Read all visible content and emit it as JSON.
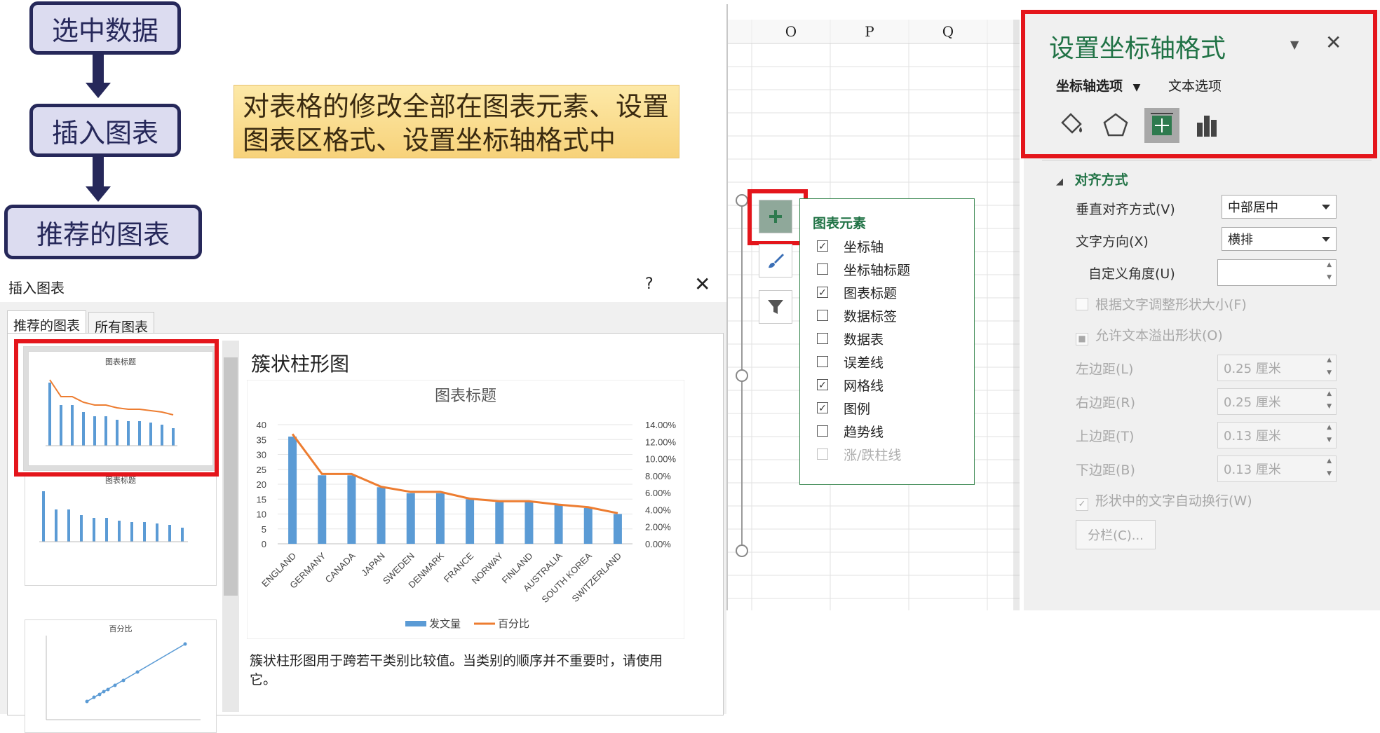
{
  "flow": {
    "step1": "选中数据",
    "step2": "插入图表",
    "step3": "推荐的图表"
  },
  "note": {
    "line1": "对表格的修改全部在图表元素、设置",
    "line2": "图表区格式、设置坐标轴格式中"
  },
  "dialog": {
    "title": "插入图表",
    "help": "?",
    "close": "✕",
    "tabs": [
      "推荐的图表",
      "所有图表"
    ],
    "chart_name": "簇状柱形图",
    "description": "簇状柱形图用于跨若干类别比较值。当类别的顺序并不重要时，请使用它。",
    "thumb_titles": [
      "图表标题",
      "图表标题",
      "百分比"
    ]
  },
  "chart_data": [
    {
      "type": "bar",
      "title": "图表标题",
      "categories": [
        "ENGLAND",
        "GERMANY",
        "CANADA",
        "JAPAN",
        "SWEDEN",
        "DENMARK",
        "FRANCE",
        "NORWAY",
        "FINLAND",
        "AUSTRALIA",
        "SOUTH KOREA",
        "SWITZERLAND"
      ],
      "series": [
        {
          "name": "发文量",
          "type": "bar",
          "axis": "left",
          "values": [
            36,
            23,
            23,
            19,
            17,
            17,
            15,
            14,
            14,
            13,
            12,
            10
          ]
        },
        {
          "name": "百分比",
          "type": "line",
          "axis": "right",
          "values": [
            12.9,
            8.2,
            8.2,
            6.7,
            6.1,
            6.1,
            5.3,
            5.0,
            5.0,
            4.6,
            4.3,
            3.6
          ]
        }
      ],
      "ylim": [
        0,
        40
      ],
      "yticks": [
        0,
        5,
        10,
        15,
        20,
        25,
        30,
        35,
        40
      ],
      "y2lim": [
        0,
        14
      ],
      "y2ticks": [
        "0.00%",
        "2.00%",
        "4.00%",
        "6.00%",
        "8.00%",
        "10.00%",
        "12.00%",
        "14.00%"
      ],
      "grid": true,
      "legend": "bottom",
      "colors": {
        "bar": "#5b9bd5",
        "line": "#ed7d31"
      }
    }
  ],
  "excel": {
    "columns": [
      "O",
      "P",
      "Q"
    ]
  },
  "elements_panel": {
    "title": "图表元素",
    "items": [
      {
        "label": "坐标轴",
        "checked": true,
        "enabled": true
      },
      {
        "label": "坐标轴标题",
        "checked": false,
        "enabled": true
      },
      {
        "label": "图表标题",
        "checked": true,
        "enabled": true
      },
      {
        "label": "数据标签",
        "checked": false,
        "enabled": true
      },
      {
        "label": "数据表",
        "checked": false,
        "enabled": true
      },
      {
        "label": "误差线",
        "checked": false,
        "enabled": true
      },
      {
        "label": "网格线",
        "checked": true,
        "enabled": true
      },
      {
        "label": "图例",
        "checked": true,
        "enabled": true
      },
      {
        "label": "趋势线",
        "checked": false,
        "enabled": true
      },
      {
        "label": "涨/跌柱线",
        "checked": false,
        "enabled": false
      }
    ]
  },
  "format_pane": {
    "title": "设置坐标轴格式",
    "tab_axis": "坐标轴选项",
    "tab_text": "文本选项",
    "section": "对齐方式",
    "vertical_align_label": "垂直对齐方式(V)",
    "vertical_align_value": "中部居中",
    "text_dir_label": "文字方向(X)",
    "text_dir_value": "横排",
    "custom_angle_label": "自定义角度(U)",
    "resize_label": "根据文字调整形状大小(F)",
    "overflow_label": "允许文本溢出形状(O)",
    "left_margin_label": "左边距(L)",
    "left_margin_value": "0.25 厘米",
    "right_margin_label": "右边距(R)",
    "right_margin_value": "0.25 厘米",
    "top_margin_label": "上边距(T)",
    "top_margin_value": "0.13 厘米",
    "bottom_margin_label": "下边距(B)",
    "bottom_margin_value": "0.13 厘米",
    "wrap_label": "形状中的文字自动换行(W)",
    "columns_button": "分栏(C)..."
  }
}
